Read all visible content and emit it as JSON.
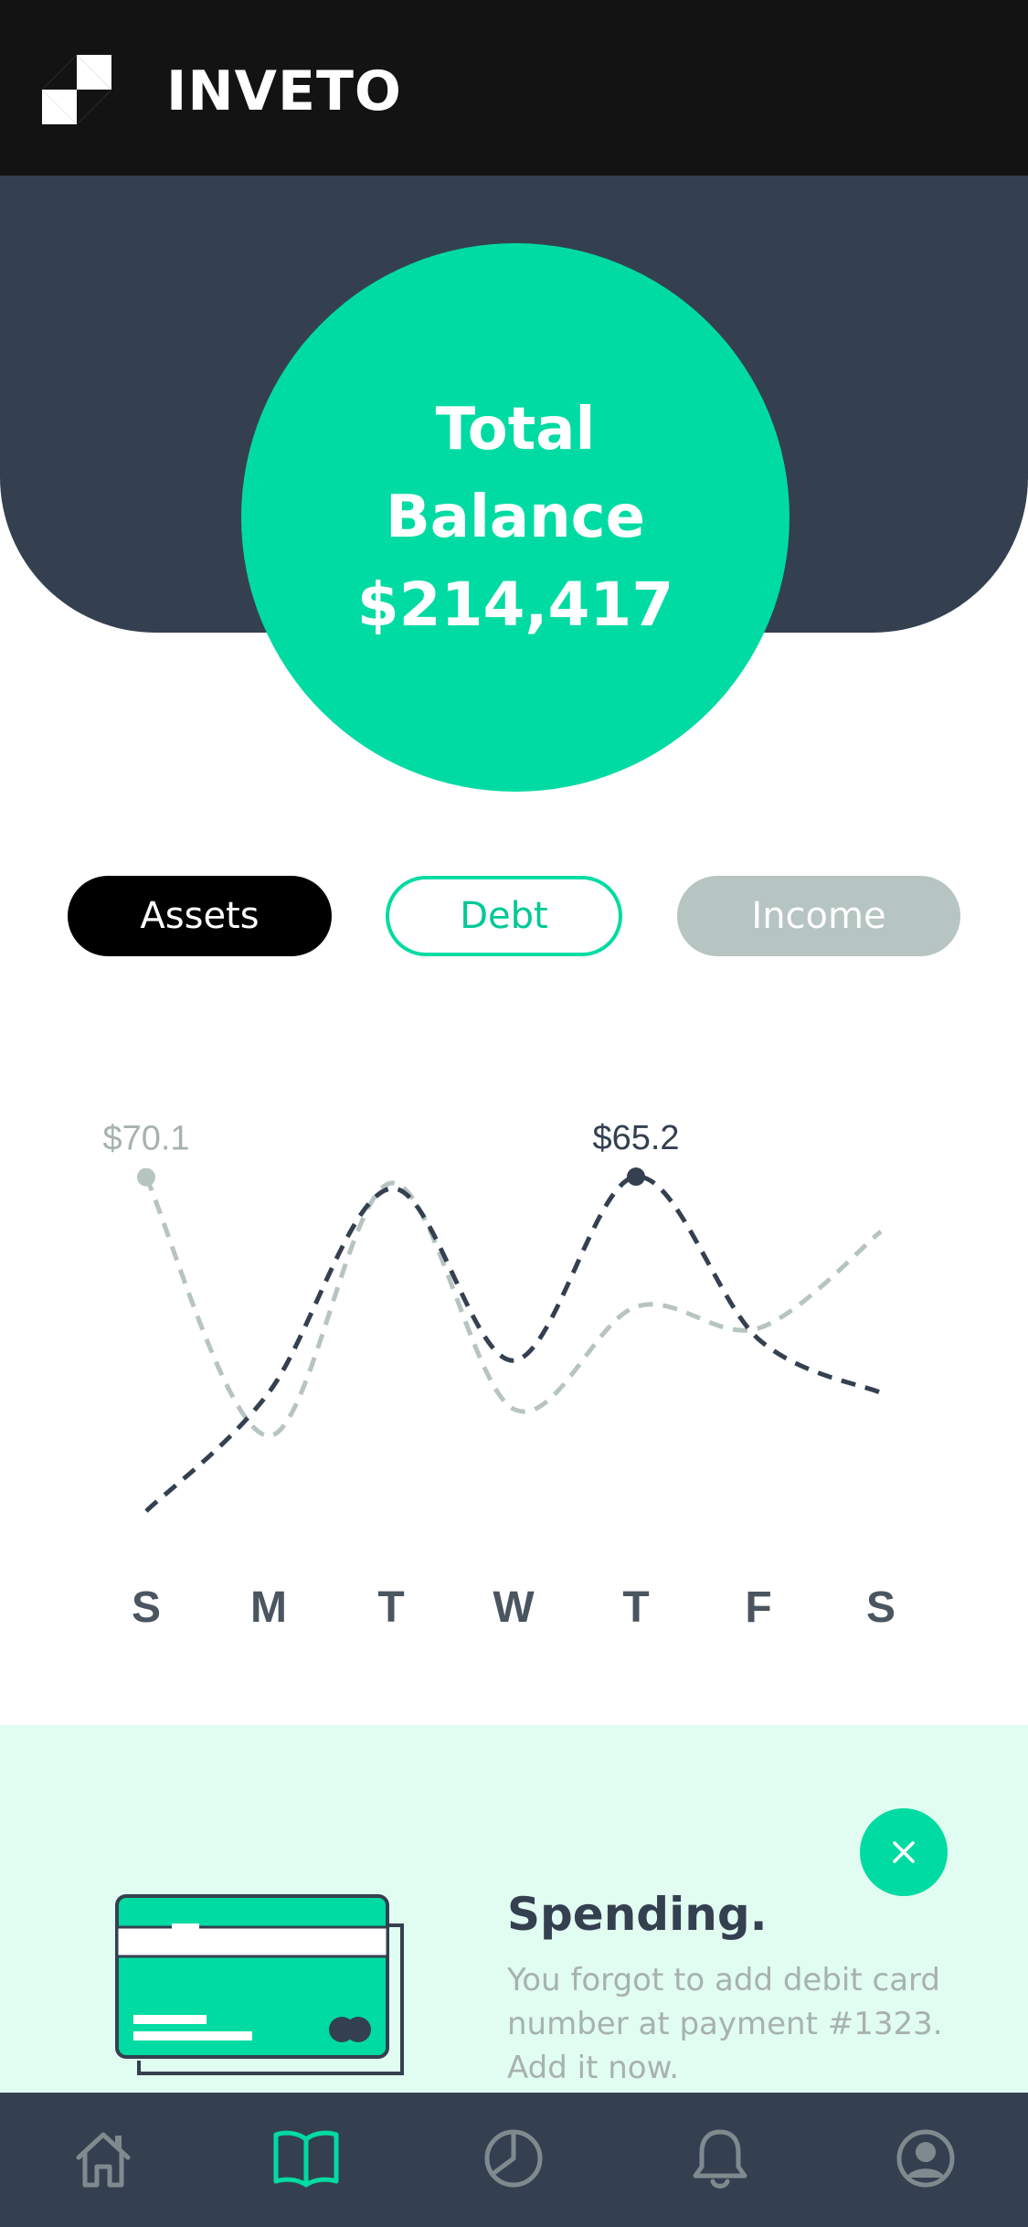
{
  "app": {
    "name": "INVETO"
  },
  "balance": {
    "title": "Total Balance",
    "value": "$214,417"
  },
  "tabs": [
    {
      "label": "Assets",
      "state": "selected"
    },
    {
      "label": "Debt",
      "state": "outlined"
    },
    {
      "label": "Income",
      "state": "muted"
    }
  ],
  "chart_data": {
    "type": "line",
    "categories": [
      "S",
      "M",
      "T",
      "W",
      "T",
      "F",
      "S"
    ],
    "series": [
      {
        "values": [
          8,
          30,
          68,
          36,
          70.2,
          40,
          30
        ],
        "style": "dashed",
        "color": "#344050"
      },
      {
        "values": [
          70.1,
          22,
          69,
          27,
          46,
          42,
          60
        ],
        "style": "dashed",
        "color": "#b6c4c2"
      }
    ],
    "annotations": [
      {
        "text": "$70.1",
        "category_index": 0,
        "value": 70.1,
        "color": "#a7b2b0"
      },
      {
        "text": "$65.2",
        "category_index": 4,
        "value": 70.2,
        "color": "#344050"
      }
    ],
    "ylim": [
      0,
      85
    ],
    "grid": false
  },
  "promo": {
    "title": "Spending.",
    "text": "You forgot to add debit card number at payment #1323. Add it now."
  },
  "nav": [
    {
      "icon": "home-icon",
      "active": false
    },
    {
      "icon": "book-icon",
      "active": true
    },
    {
      "icon": "pie-chart-icon",
      "active": false
    },
    {
      "icon": "bell-icon",
      "active": false
    },
    {
      "icon": "profile-icon",
      "active": false
    }
  ],
  "colors": {
    "accent": "#00dba3",
    "navy": "#344050",
    "muted": "#b6c4c2",
    "promo_bg": "#e1fcf0",
    "topbar": "#131313"
  }
}
